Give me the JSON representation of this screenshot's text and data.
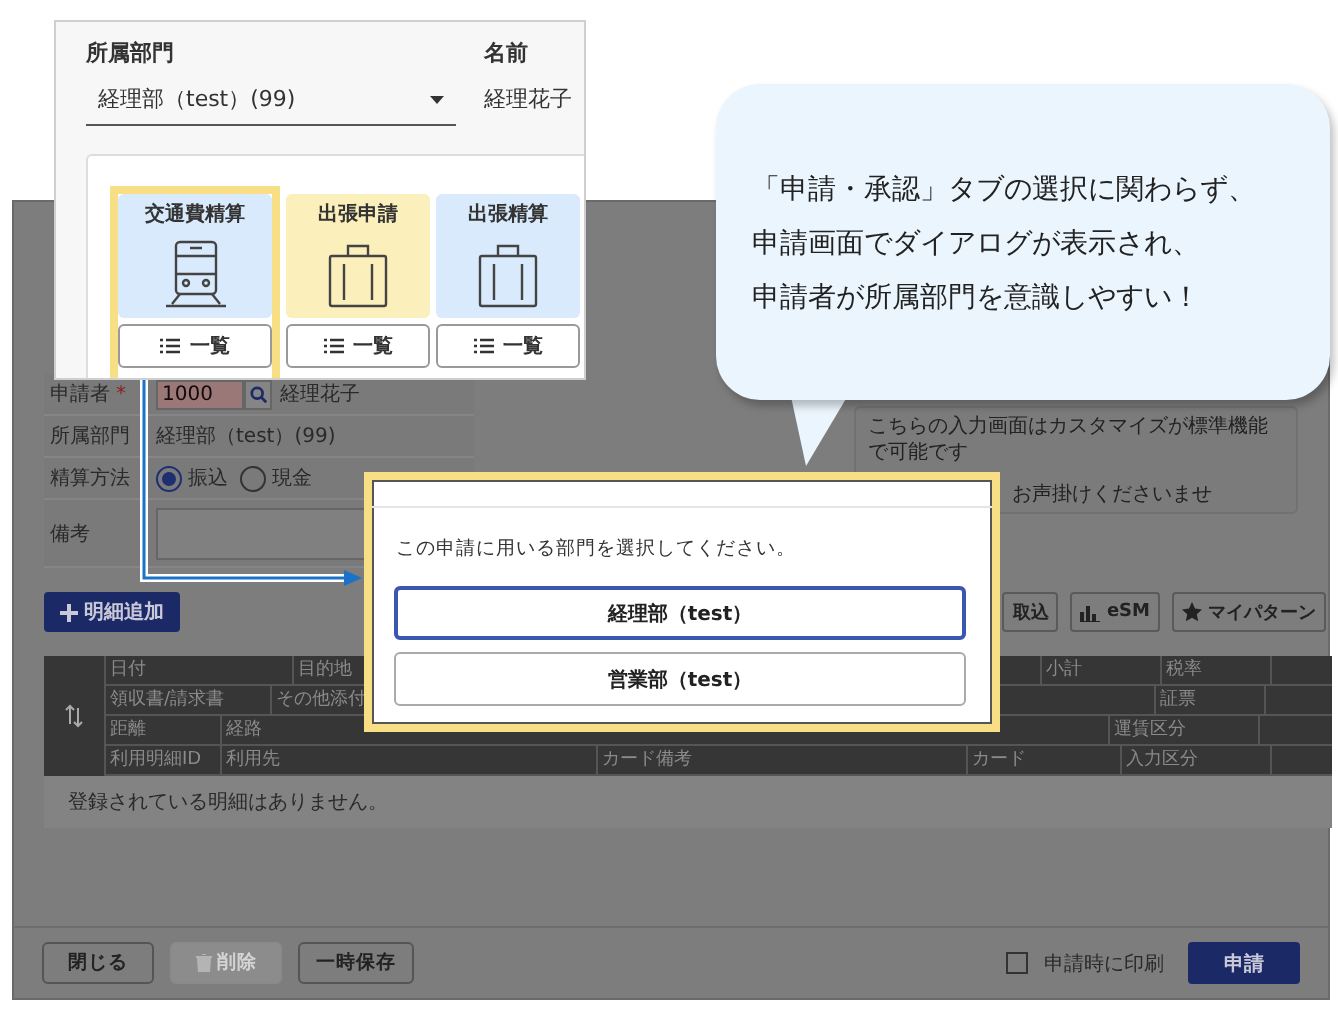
{
  "form_screen": {
    "required_mark": "*",
    "form_rows": [
      {
        "kind": "applicant",
        "label": "申請者",
        "required": true,
        "value": "1000",
        "person": "経理花子"
      },
      {
        "kind": "text",
        "label": "所属部門",
        "required": false,
        "value": "経理部（test）(99)"
      },
      {
        "kind": "radio",
        "label": "精算方法",
        "required": false,
        "options": [
          {
            "label": "振込",
            "selected": true
          },
          {
            "label": "現金",
            "selected": false
          }
        ]
      },
      {
        "kind": "textarea",
        "label": "備考",
        "required": false
      }
    ],
    "notice": [
      "こちらの入力画面はカスタマイズが標準機能で可能です",
      "お声掛けくださいませ"
    ],
    "add_button": "明細追加",
    "tool_buttons": [
      {
        "kind": "plain",
        "label": "取込"
      },
      {
        "kind": "chart",
        "label": "eSM"
      },
      {
        "kind": "star",
        "label": "マイパターン"
      }
    ],
    "table_header": [
      [
        "日付",
        "目的地",
        "小計",
        "税率"
      ],
      [
        "領収書/請求書",
        "その他添付",
        "証票"
      ],
      [
        "距離",
        "経路",
        "運賃区分"
      ],
      [
        "利用明細ID",
        "利用先",
        "カード備考",
        "カード",
        "入力区分"
      ]
    ],
    "empty_message": "登録されている明細はありません。",
    "footer_buttons": [
      {
        "label": "閉じる",
        "disabled": false
      },
      {
        "label": "削除",
        "disabled": true
      },
      {
        "label": "一時保存",
        "disabled": false
      }
    ],
    "print_checkbox": {
      "label": "申請時に印刷",
      "checked": false
    },
    "submit_button": "申請"
  },
  "menu_card": {
    "department_label": "所属部門",
    "department_value": "経理部（test）(99)",
    "name_label": "名前",
    "name_value": "経理花子",
    "tiles": [
      {
        "kind": "train",
        "title": "交通費精算",
        "color": "#d8eafb",
        "selected": true,
        "list_label": "一覧"
      },
      {
        "kind": "bag",
        "title": "出張申請",
        "color": "#fbefbb",
        "selected": false,
        "list_label": "一覧"
      },
      {
        "kind": "bag",
        "title": "出張精算",
        "color": "#d8eafb",
        "selected": false,
        "list_label": "一覧"
      }
    ]
  },
  "speech_bubble": {
    "lines": [
      "「申請・承認」タブの選択に関わらず、",
      "申請画面でダイアログが表示され、",
      "申請者が所属部門を意識しやすい！"
    ]
  },
  "department_dialog": {
    "message": "この申請に用いる部門を選択してください。",
    "options": [
      {
        "label": "経理部（test）",
        "selected": true
      },
      {
        "label": "営業部（test）",
        "selected": false
      }
    ]
  }
}
